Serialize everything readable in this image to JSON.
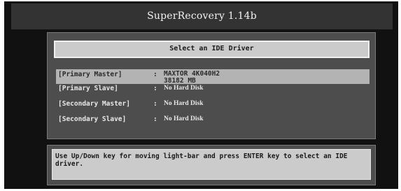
{
  "app": {
    "title": "SuperRecovery 1.14b"
  },
  "dialog": {
    "header": "Select an IDE Driver"
  },
  "drives": [
    {
      "name": "[Primary Master]",
      "separator": ":",
      "status_line1": "MAXTOR 4K040H2",
      "status_line2": "38182 MB",
      "selected": true
    },
    {
      "name": "[Primary Slave]",
      "separator": ":",
      "status": "No Hard Disk",
      "selected": false
    },
    {
      "name": "[Secondary Master]",
      "separator": ":",
      "status": "No Hard Disk",
      "selected": false
    },
    {
      "name": "[Secondary Slave]",
      "separator": ":",
      "status": "No Hard Disk",
      "selected": false
    }
  ],
  "help": {
    "text": "Use Up/Down key for moving light-bar and press ENTER key to select an IDE driver."
  },
  "colors": {
    "background": "#111111",
    "panel": "#4d4d4d",
    "highlight": "#b3b3b3",
    "text_light": "#e8e8e8",
    "text_dark": "#1a1a1a"
  }
}
